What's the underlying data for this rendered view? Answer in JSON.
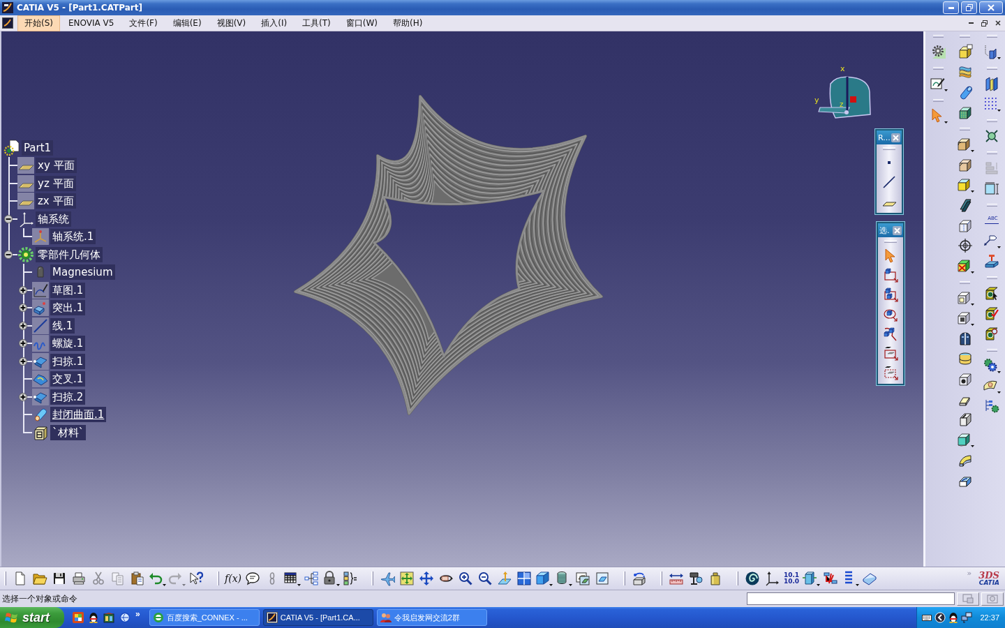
{
  "window": {
    "title": "CATIA V5 - [Part1.CATPart]"
  },
  "menu": [
    {
      "label": "开始(S)",
      "selected": true
    },
    {
      "label": "ENOVIA V5",
      "selected": false
    },
    {
      "label": "文件(F)",
      "selected": false
    },
    {
      "label": "编辑(E)",
      "selected": false
    },
    {
      "label": "视图(V)",
      "selected": false
    },
    {
      "label": "插入(I)",
      "selected": false
    },
    {
      "label": "工具(T)",
      "selected": false
    },
    {
      "label": "窗口(W)",
      "selected": false
    },
    {
      "label": "帮助(H)",
      "selected": false
    }
  ],
  "tree": {
    "label": "Part1",
    "kind": "part",
    "current": false,
    "children": [
      {
        "label": "xy 平面",
        "kind": "plane",
        "current": false
      },
      {
        "label": "yz 平面",
        "kind": "plane",
        "current": false
      },
      {
        "label": "zx 平面",
        "kind": "plane",
        "current": false
      },
      {
        "label": "轴系统",
        "kind": "axis_set",
        "current": false,
        "expanded": true,
        "children": [
          {
            "label": "轴系统.1",
            "kind": "axis_system",
            "current": false
          }
        ]
      },
      {
        "label": "零部件几何体",
        "kind": "body",
        "current": false,
        "expanded": true,
        "children": [
          {
            "label": "Magnesium",
            "kind": "material",
            "current": false
          },
          {
            "label": "草图.1",
            "kind": "sketch",
            "current": false,
            "expanded": false
          },
          {
            "label": "突出.1",
            "kind": "pad",
            "current": false,
            "expanded": false
          },
          {
            "label": "线.1",
            "kind": "line",
            "current": false,
            "expanded": false
          },
          {
            "label": "螺旋.1",
            "kind": "helix",
            "current": false,
            "expanded": false
          },
          {
            "label": "扫掠.1",
            "kind": "sweep",
            "current": false,
            "expanded": false
          },
          {
            "label": "交叉.1",
            "kind": "intersection",
            "current": false
          },
          {
            "label": "扫掠.2",
            "kind": "sweep",
            "current": false,
            "expanded": false
          },
          {
            "label": "封闭曲面.1",
            "kind": "closed_surface",
            "current": true
          },
          {
            "label": "`材料`",
            "kind": "material_table",
            "current": false
          }
        ]
      }
    ]
  },
  "compass": {
    "x_label": "x",
    "y_label": "y",
    "z_label": "z"
  },
  "floating_toolbars": [
    {
      "kind": "reference",
      "title": "R..."
    },
    {
      "kind": "selection",
      "title": "选."
    }
  ],
  "right_toolbars": {
    "columns": [
      [
        [
          {
            "disabled": false
          }
        ],
        [
          {
            "disabled": false
          }
        ],
        [
          {
            "disabled": false
          }
        ]
      ],
      [
        [
          {
            "disabled": false
          },
          {
            "disabled": false
          },
          {
            "disabled": false
          },
          {
            "disabled": false
          }
        ],
        [
          {
            "disabled": false
          },
          {
            "disabled": false
          },
          {
            "disabled": false
          },
          {
            "disabled": false
          },
          {
            "disabled": false
          },
          {
            "disabled": false
          },
          {
            "disabled": false
          }
        ],
        [
          {
            "disabled": false
          },
          {
            "disabled": false
          },
          {
            "disabled": false
          },
          {
            "disabled": false
          },
          {
            "disabled": false
          },
          {
            "disabled": false
          },
          {
            "disabled": false
          },
          {
            "disabled": false
          },
          {
            "disabled": false
          },
          {
            "disabled": false
          }
        ]
      ],
      [
        [
          {
            "disabled": false
          }
        ],
        [
          {
            "disabled": false
          },
          {
            "disabled": false
          }
        ],
        [
          {
            "disabled": false
          }
        ],
        [
          {
            "disabled": true
          },
          {
            "disabled": false
          }
        ],
        [
          {
            "label": [
              "ABC"
            ],
            "disabled": false
          },
          {
            "disabled": false
          },
          {
            "disabled": false
          }
        ],
        [
          {
            "disabled": false
          },
          {
            "disabled": false
          },
          {
            "disabled": false
          }
        ],
        [
          {
            "disabled": false
          },
          {
            "disabled": false
          },
          {
            "disabled": false
          }
        ]
      ]
    ]
  },
  "bottom_toolbar": {
    "groups": [
      [
        {
          "disabled": false
        },
        {
          "disabled": false
        },
        {
          "disabled": false
        },
        {
          "disabled": false
        },
        {
          "disabled": true
        },
        {
          "disabled": true
        },
        {
          "disabled": false
        },
        {
          "disabled": false
        },
        {
          "disabled": true
        },
        {
          "disabled": false
        }
      ],
      [
        {
          "label": [
            "f(x)"
          ],
          "disabled": false
        },
        {
          "disabled": false
        },
        {
          "disabled": true
        },
        {
          "disabled": false
        },
        {
          "disabled": false
        },
        {
          "disabled": false
        },
        {
          "disabled": false
        }
      ],
      [
        {
          "disabled": false
        },
        {
          "disabled": false
        },
        {
          "disabled": false
        },
        {
          "disabled": false
        },
        {
          "disabled": false
        },
        {
          "disabled": false
        },
        {
          "disabled": false
        },
        {
          "disabled": false
        },
        {
          "disabled": false
        },
        {
          "disabled": false
        },
        {
          "disabled": false
        },
        {
          "disabled": false
        }
      ],
      [
        {
          "disabled": false
        }
      ],
      [
        {
          "disabled": false
        },
        {
          "disabled": false
        },
        {
          "disabled": false
        }
      ],
      [
        {
          "disabled": false
        },
        {
          "disabled": false
        },
        {
          "label": [
            "10.1",
            "10.0"
          ],
          "disabled": false
        },
        {
          "disabled": false
        },
        {
          "disabled": false
        },
        {
          "disabled": false
        },
        {
          "disabled": false
        }
      ]
    ],
    "overflow": "»"
  },
  "logo": {
    "mark": "3DS",
    "name": "CATIA"
  },
  "status_bar": {
    "message": "选择一个对象或命令"
  },
  "taskbar": {
    "start": "start",
    "quick_launch_overflow": "»",
    "tasks": [
      {
        "label": "百度搜索_CONNEX - ...",
        "kind": "browser",
        "selected": false
      },
      {
        "label": "CATIA V5 - [Part1.CA...",
        "kind": "app",
        "selected": true
      },
      {
        "label": "令我启发网交流2群",
        "kind": "chat",
        "selected": false
      }
    ],
    "clock": "22:37"
  }
}
